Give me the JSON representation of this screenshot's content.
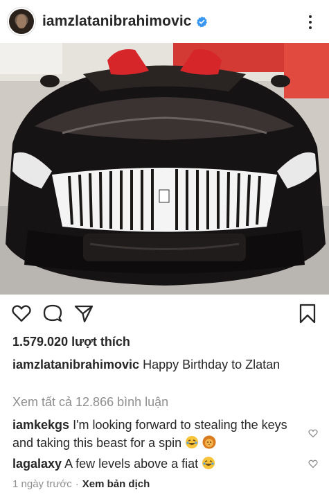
{
  "post": {
    "username": "iamzlatanibrahimovic",
    "likes_text": "1.579.020 lượt thích",
    "caption_user": "iamzlatanibrahimovic",
    "caption_text": " Happy Birthday to Zlatan",
    "view_all_comments": "Xem tất cả 12.866 bình luận",
    "comments": [
      {
        "user": "iamkekgs",
        "text": " I'm looking forward to stealing the keys and taking this beast for a spin "
      },
      {
        "user": "lagalaxy",
        "text": " A few levels above a fiat "
      }
    ],
    "time_ago": "1 ngày trước",
    "separator": "·",
    "translate_label": "Xem bản dịch"
  },
  "icons": {
    "verified": "verified-badge-icon",
    "more": "more-options-icon",
    "like": "heart-icon",
    "comment": "comment-bubble-icon",
    "share": "paper-plane-icon",
    "save": "bookmark-icon"
  },
  "colors": {
    "text": "#262626",
    "muted": "#8e8e8e",
    "verified_blue": "#3897f0"
  }
}
